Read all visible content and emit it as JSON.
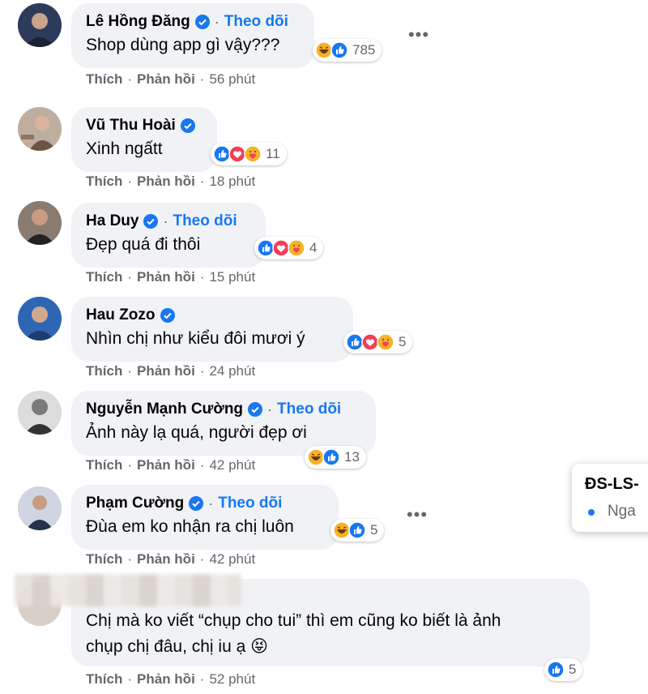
{
  "comments": [
    {
      "name": "Lê Hồng Đăng",
      "verified": true,
      "follow": "Theo dõi",
      "text": "Shop dùng app gì vậy???",
      "reactions": [
        "haha",
        "like"
      ],
      "count": "785",
      "like": "Thích",
      "reply": "Phản hồi",
      "time": "56 phút",
      "avatar_color": "#3a4a6b"
    },
    {
      "name": "Vũ Thu Hoài",
      "verified": true,
      "follow": "",
      "text": "Xinh ngấtt",
      "reactions": [
        "like",
        "love",
        "care"
      ],
      "count": "11",
      "like": "Thích",
      "reply": "Phản hồi",
      "time": "18 phút",
      "avatar_color": "#b09a8a"
    },
    {
      "name": "Ha Duy",
      "verified": true,
      "follow": "Theo dõi",
      "text": "Đẹp quá đi thôi",
      "reactions": [
        "like",
        "love",
        "care"
      ],
      "count": "4",
      "like": "Thích",
      "reply": "Phản hồi",
      "time": "15 phút",
      "avatar_color": "#7a6a5e"
    },
    {
      "name": "Hau Zozo",
      "verified": true,
      "follow": "",
      "text": "Nhìn chị như kiểu đôi mươi ý",
      "reactions": [
        "like",
        "love",
        "care"
      ],
      "count": "5",
      "like": "Thích",
      "reply": "Phản hồi",
      "time": "24 phút",
      "avatar_color": "#2e5fa8"
    },
    {
      "name": "Nguyễn Mạnh Cường",
      "verified": true,
      "follow": "Theo dõi",
      "text": "Ảnh này lạ quá, người đẹp ơi",
      "reactions": [
        "haha",
        "like"
      ],
      "count": "13",
      "like": "Thích",
      "reply": "Phản hồi",
      "time": "42 phút",
      "avatar_color": "#555555"
    },
    {
      "name": "Phạm Cường",
      "verified": true,
      "follow": "Theo dõi",
      "text": "Đùa em ko nhận ra chị luôn",
      "reactions": [
        "haha",
        "like"
      ],
      "count": "5",
      "like": "Thích",
      "reply": "Phản hồi",
      "time": "42 phút",
      "avatar_color": "#4a5a78"
    },
    {
      "name": "",
      "verified": false,
      "follow": "",
      "text_line1": "Chị mà ko viết “chụp cho tui” thì em cũng ko biết là ảnh",
      "text_line2": "chụp chị đâu, chị iu ạ 😝",
      "reactions": [
        "like"
      ],
      "count": "5",
      "like": "Thích",
      "reply": "Phản hồi",
      "time": "52 phút",
      "avatar_color": "#d9cfc7"
    }
  ],
  "popup": {
    "title": "ĐS-LS-",
    "item": "Nga"
  },
  "colors": {
    "accent": "#1877f2",
    "bubble": "#f0f2f5",
    "meta": "#65676b"
  }
}
